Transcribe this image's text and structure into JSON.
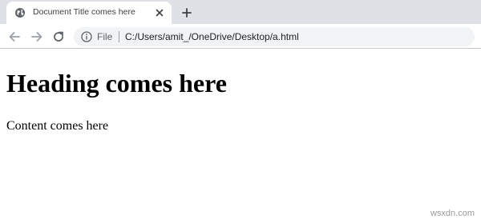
{
  "browser": {
    "tab": {
      "title": "Document Title comes here",
      "favicon": "globe-icon",
      "close_icon": "close-icon"
    },
    "new_tab_icon": "plus-icon",
    "toolbar": {
      "back_icon": "arrow-left-icon",
      "forward_icon": "arrow-right-icon",
      "reload_icon": "reload-icon",
      "info_icon": "info-icon",
      "scheme_label": "File",
      "url": "C:/Users/amit_/OneDrive/Desktop/a.html"
    }
  },
  "page": {
    "heading": "Heading comes here",
    "paragraph": "Content comes here"
  },
  "watermark": "wsxdn.com",
  "colors": {
    "tabstrip": "#dee1e6",
    "omnibox": "#f1f3f4",
    "icon": "#5f6368"
  }
}
